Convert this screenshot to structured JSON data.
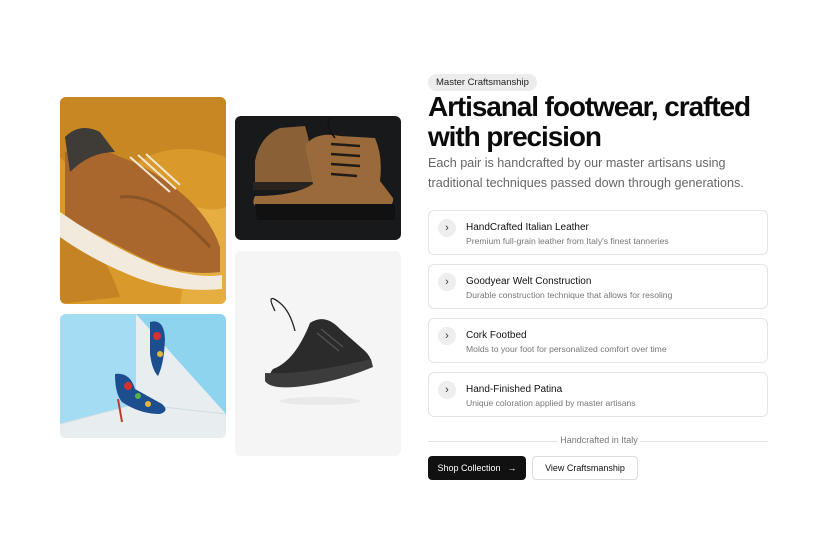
{
  "hero": {
    "badge": "Master Craftsmanship",
    "title": "Artisanal footwear, crafted with precision",
    "subtitle": "Each pair is handcrafted by our master artisans using traditional techniques passed down through generations."
  },
  "features": [
    {
      "title": "HandCrafted Italian Leather",
      "description": "Premium full-grain leather from Italy's finest tanneries",
      "icon": "chevron-right-icon"
    },
    {
      "title": "Goodyear Welt Construction",
      "description": "Durable construction technique that allows for resoling",
      "icon": "chevron-right-icon"
    },
    {
      "title": "Cork Footbed",
      "description": "Molds to your foot for personalized comfort over time",
      "icon": "chevron-right-icon"
    },
    {
      "title": "Hand-Finished Patina",
      "description": "Unique coloration applied by master artisans",
      "icon": "chevron-right-icon"
    }
  ],
  "divider_text": "Handcrafted in Italy",
  "actions": {
    "primary_label": "Shop Collection",
    "primary_icon": "arrow-right-icon",
    "secondary_label": "View Craftsmanship"
  },
  "icons": {
    "chevron": "›",
    "arrow": "→"
  },
  "colors": {
    "primary_button": "#111111",
    "badge_bg": "#ececec",
    "mustard": "#d99a2b",
    "sky": "#8fd4ef"
  }
}
